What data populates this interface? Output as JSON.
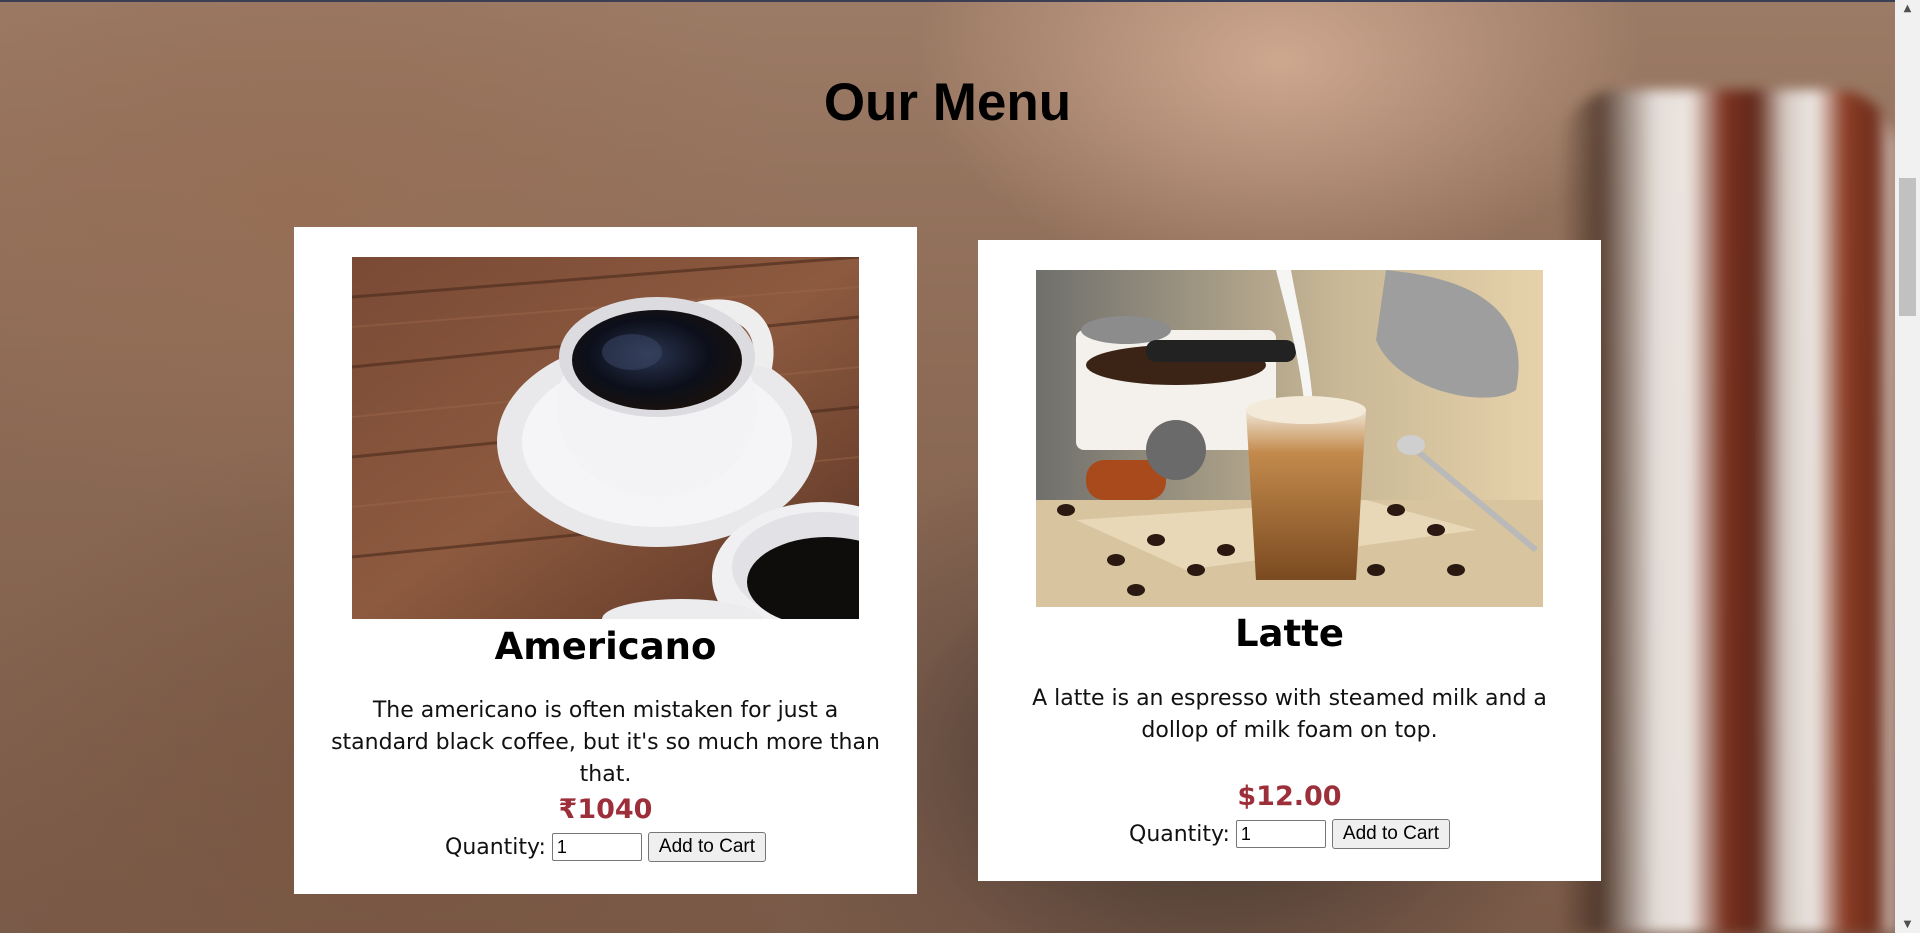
{
  "page": {
    "title": "Our Menu"
  },
  "menu": {
    "items": [
      {
        "name": "Americano",
        "description": "The americano is often mistaken for just a standard black coffee, but it's so much more than that.",
        "price": "₹1040",
        "quantity_label": "Quantity:",
        "quantity_value": "1",
        "add_button": "Add to Cart"
      },
      {
        "name": "Latte",
        "description": "A latte is an espresso with steamed milk and a dollop of milk foam on top.",
        "price": "$12.00",
        "quantity_label": "Quantity:",
        "quantity_value": "1",
        "add_button": "Add to Cart"
      }
    ]
  },
  "colors": {
    "price": "#9c2f3a",
    "card_bg": "#ffffff"
  }
}
